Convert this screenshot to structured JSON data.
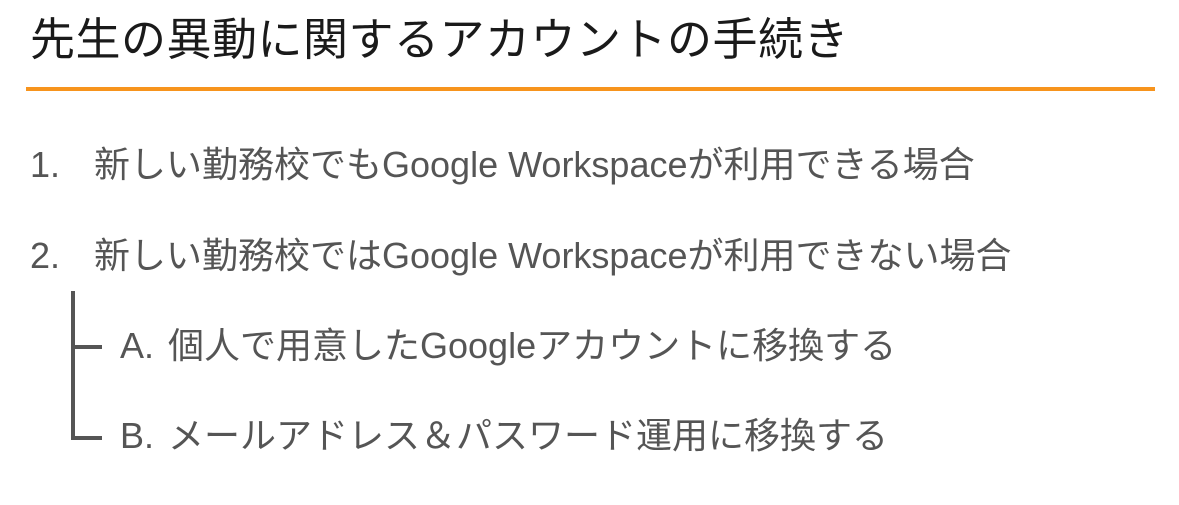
{
  "slide": {
    "title": "先生の異動に関するアカウントの手続き",
    "accent_color": "#f7941d",
    "items": [
      {
        "number": "1.",
        "text": "新しい勤務校でもGoogle Workspaceが利用できる場合"
      },
      {
        "number": "2.",
        "text": "新しい勤務校ではGoogle Workspaceが利用できない場合"
      }
    ],
    "subitems": [
      {
        "letter": "A.",
        "text": "個人で用意したGoogleアカウントに移換する"
      },
      {
        "letter": "B.",
        "text": "メールアドレス＆パスワード運用に移換する"
      }
    ]
  }
}
